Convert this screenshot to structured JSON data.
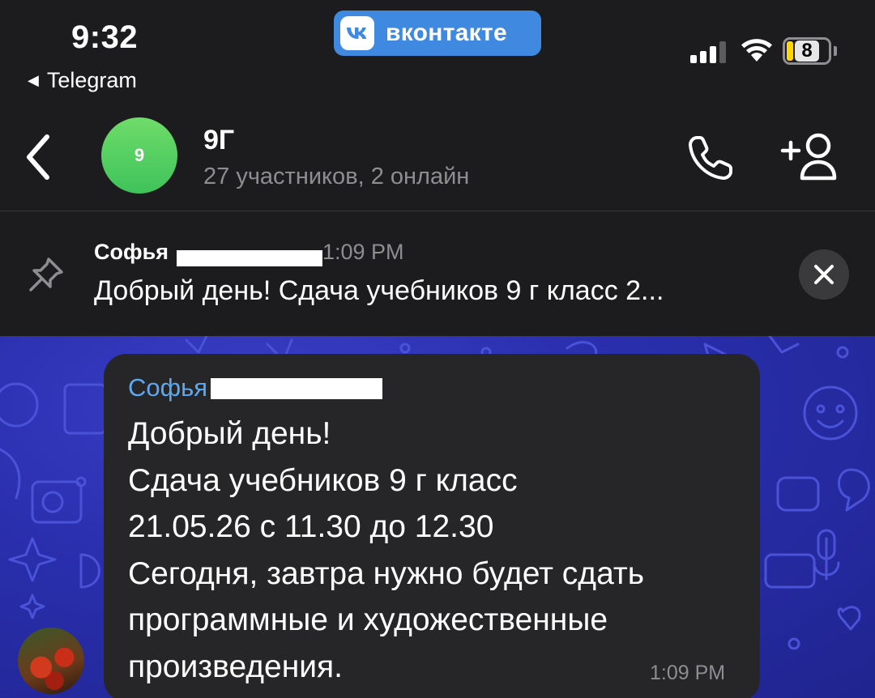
{
  "status_bar": {
    "time": "9:32",
    "back_app_label": "Telegram",
    "vk_banner": "вконтакте",
    "battery_level": "8",
    "signal_bars": 3
  },
  "header": {
    "avatar_initial": "9",
    "title": "9Г",
    "subtitle": "27 участников, 2 онлайн"
  },
  "pinned": {
    "author": "Софья",
    "time": "1:09 PM",
    "text": "Добрый день! Сдача учебников 9 г класс 2..."
  },
  "message": {
    "author": "Софья",
    "text_lines": [
      "Добрый день!",
      "Сдача учебников 9 г класс",
      "21.05.26 с 11.30 до 12.30",
      "Сегодня, завтра нужно будет сдать",
      "программные и художественные",
      "произведения."
    ],
    "time": "1:09 PM"
  },
  "colors": {
    "background": "#1c1c1e",
    "accent_blue": "#5ea8f0",
    "vk_blue": "#3f8ae0",
    "bubble": "#262628",
    "chat_wallpaper": "#2a2fae",
    "group_avatar": "#4cca5f"
  },
  "icons": [
    "back-chevron-icon",
    "phone-icon",
    "add-member-icon",
    "pin-icon",
    "close-icon",
    "wifi-icon",
    "battery-icon",
    "signal-icon"
  ]
}
